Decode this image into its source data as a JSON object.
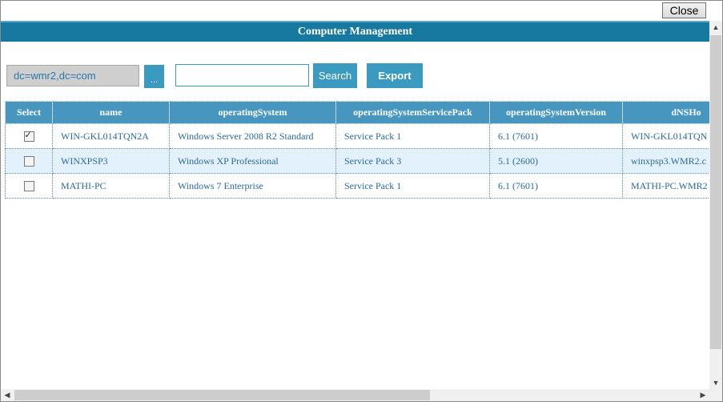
{
  "close_label": "Close",
  "title": "Computer Management",
  "toolbar": {
    "dn_value": "dc=wmr2,dc=com",
    "browse_label": "...",
    "search_value": "",
    "search_label": "Search",
    "export_label": "Export"
  },
  "table": {
    "headers": [
      "Select",
      "name",
      "operatingSystem",
      "operatingSystemServicePack",
      "operatingSystemVersion",
      "dNSHo"
    ],
    "rows": [
      {
        "checked": true,
        "name": "WIN-GKL014TQN2A",
        "os": "Windows Server 2008 R2 Standard",
        "sp": "Service Pack 1",
        "version": "6.1 (7601)",
        "dns": "WIN-GKL014TQN"
      },
      {
        "checked": false,
        "name": "WINXPSP3",
        "os": "Windows XP Professional",
        "sp": "Service Pack 3",
        "version": "5.1 (2600)",
        "dns": "winxpsp3.WMR2.c"
      },
      {
        "checked": false,
        "name": "MATHI-PC",
        "os": "Windows 7 Enterprise",
        "sp": "Service Pack 1",
        "version": "6.1 (7601)",
        "dns": "MATHI-PC.WMR2"
      }
    ]
  },
  "scrollbars": {
    "up": "▲",
    "down": "▼",
    "left": "◀",
    "right": "▶"
  }
}
